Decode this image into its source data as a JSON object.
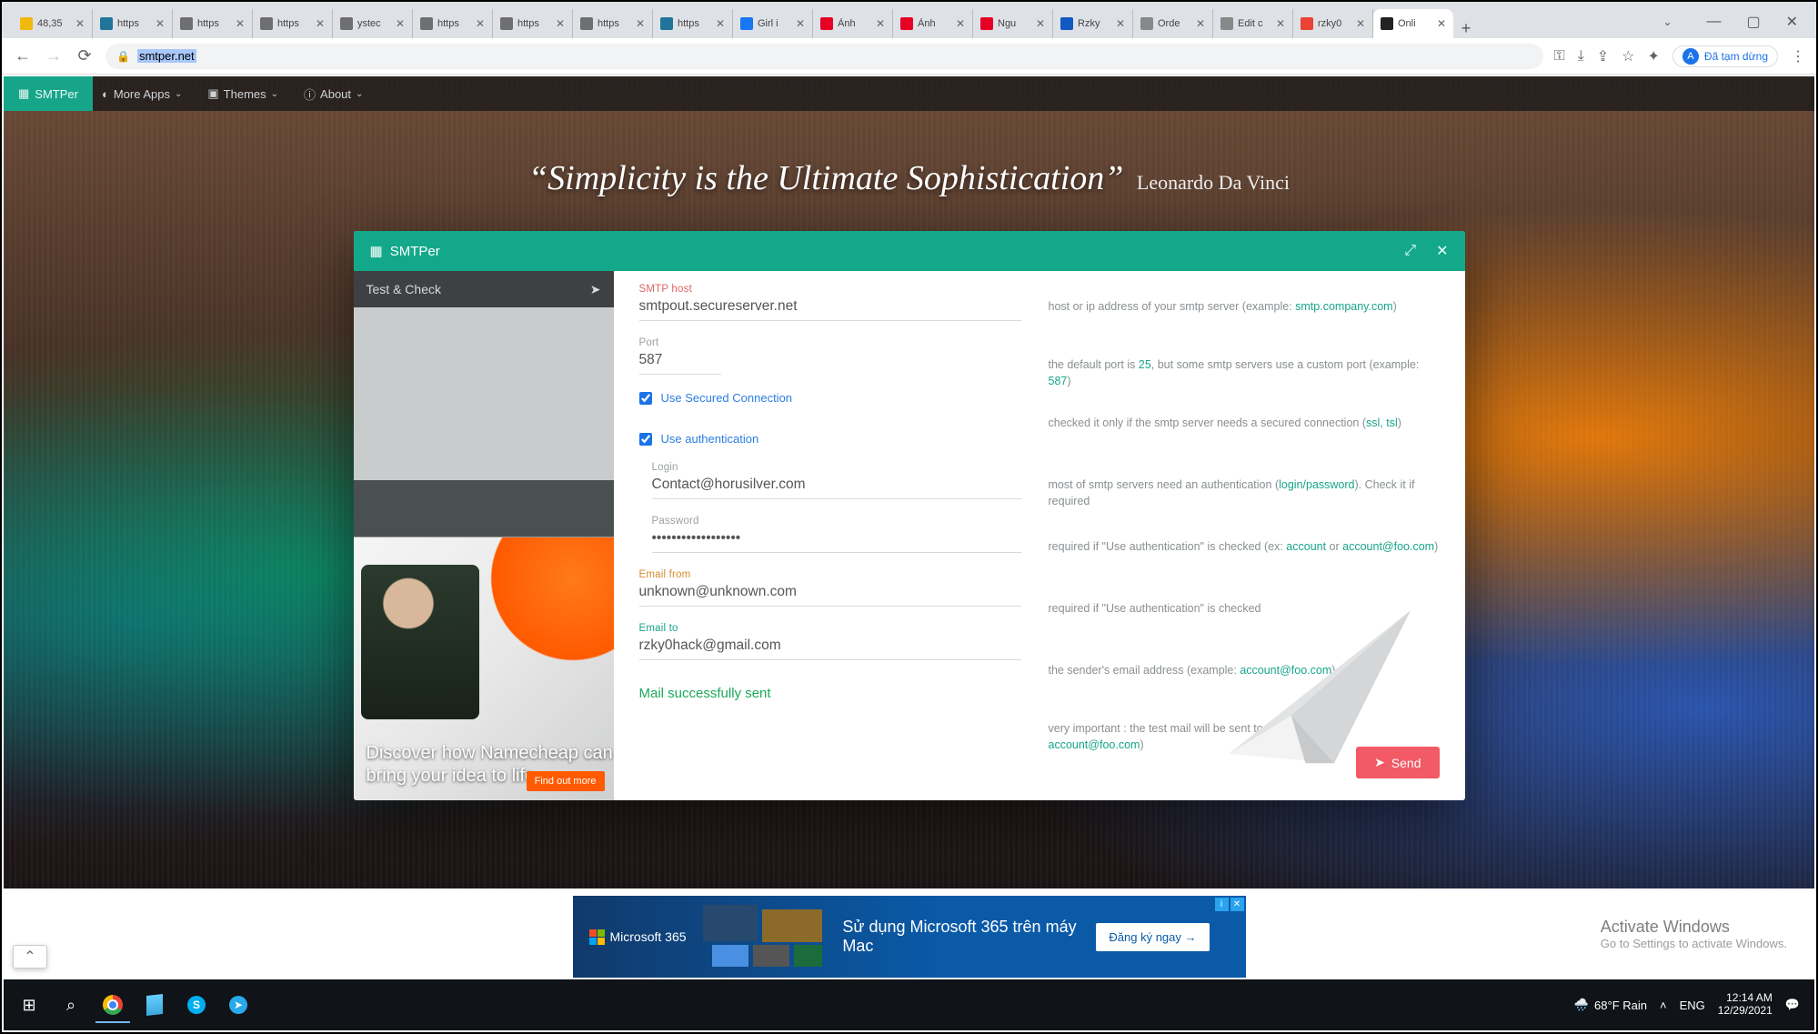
{
  "browser": {
    "tabs": [
      {
        "title": "48,35",
        "fav": "#f0b90b"
      },
      {
        "title": "https",
        "fav": "#21759b"
      },
      {
        "title": "https",
        "fav": "#6f6f6f"
      },
      {
        "title": "https",
        "fav": "#6f6f6f"
      },
      {
        "title": "ystec",
        "fav": "#6f6f6f"
      },
      {
        "title": "https",
        "fav": "#6f6f6f"
      },
      {
        "title": "https",
        "fav": "#6f6f6f"
      },
      {
        "title": "https",
        "fav": "#6f6f6f"
      },
      {
        "title": "https",
        "fav": "#21759b"
      },
      {
        "title": "Girl i",
        "fav": "#1877f2"
      },
      {
        "title": "Ảnh",
        "fav": "#e60023"
      },
      {
        "title": "Ảnh",
        "fav": "#e60023"
      },
      {
        "title": "Ngu",
        "fav": "#e60023"
      },
      {
        "title": "Rzky",
        "fav": "#1259c3"
      },
      {
        "title": "Orde",
        "fav": "#888"
      },
      {
        "title": "Edit c",
        "fav": "#888"
      },
      {
        "title": "rzky0",
        "fav": "#ea4335"
      },
      {
        "title": "Onli",
        "fav": "#222",
        "active": true
      }
    ],
    "url_prefix": "smtper.net",
    "profile_label": "Đã tạm dừng",
    "profile_letter": "A"
  },
  "site_nav": {
    "brand": "SMTPer",
    "items": [
      {
        "label": "More Apps"
      },
      {
        "label": "Themes"
      },
      {
        "label": "About"
      }
    ]
  },
  "quote": {
    "text": "“Simplicity is the Ultimate Sophistication”",
    "author": "Leonardo Da Vinci"
  },
  "modal": {
    "title": "SMTPer",
    "side_tab": "Test & Check",
    "ad_headline": "Discover how Namecheap can bring your idea to life.",
    "ad_cta": "Find out more",
    "send_label": "Send"
  },
  "form": {
    "smtp_host_label": "SMTP host",
    "smtp_host": "smtpout.secureserver.net",
    "port_label": "Port",
    "port": "587",
    "secured_label": "Use Secured Connection",
    "auth_label": "Use authentication",
    "login_label": "Login",
    "login": "Contact@horusilver.com",
    "password_label": "Password",
    "password": "••••••••••••••••••",
    "email_from_label": "Email from",
    "email_from": "unknown@unknown.com",
    "email_to_label": "Email to",
    "email_to": "rzky0hack@gmail.com",
    "success": "Mail successfully sent"
  },
  "help": {
    "host_a": "host or ip address of your smtp server (example: ",
    "host_link": "smtp.company.com",
    "host_b": ")",
    "port_a": "the default port is ",
    "port_link1": "25",
    "port_b": ", but some smtp servers use a custom port (example: ",
    "port_link2": "587",
    "port_c": ")",
    "ssl_a": "checked it only if the smtp server needs a secured connection (",
    "ssl_link": "ssl, tsl",
    "ssl_b": ")",
    "auth_a": "most of smtp servers need an authentication (",
    "auth_link": "login/password",
    "auth_b": "). Check it if required",
    "login_a": "required if \"Use authentication\" is checked (ex: ",
    "login_link1": "account",
    "login_mid": " or ",
    "login_link2": "account@foo.com",
    "login_b": ")",
    "pwd": "required if \"Use authentication\" is checked",
    "from_a": "the sender's email address (example: ",
    "from_link": "account@foo.com",
    "from_b": ")",
    "to_a": "very important : the test mail will be sent to this address (ex: ",
    "to_link": "account@foo.com",
    "to_b": ")"
  },
  "banner": {
    "ms": "Microsoft 365",
    "text": "Sử dụng Microsoft 365 trên máy Mac",
    "cta": "Đăng ký ngay →"
  },
  "activate": {
    "title": "Activate Windows",
    "sub": "Go to Settings to activate Windows."
  },
  "taskbar": {
    "weather": "68°F Rain",
    "lang": "ENG",
    "time": "12:14 AM",
    "date": "12/29/2021"
  }
}
